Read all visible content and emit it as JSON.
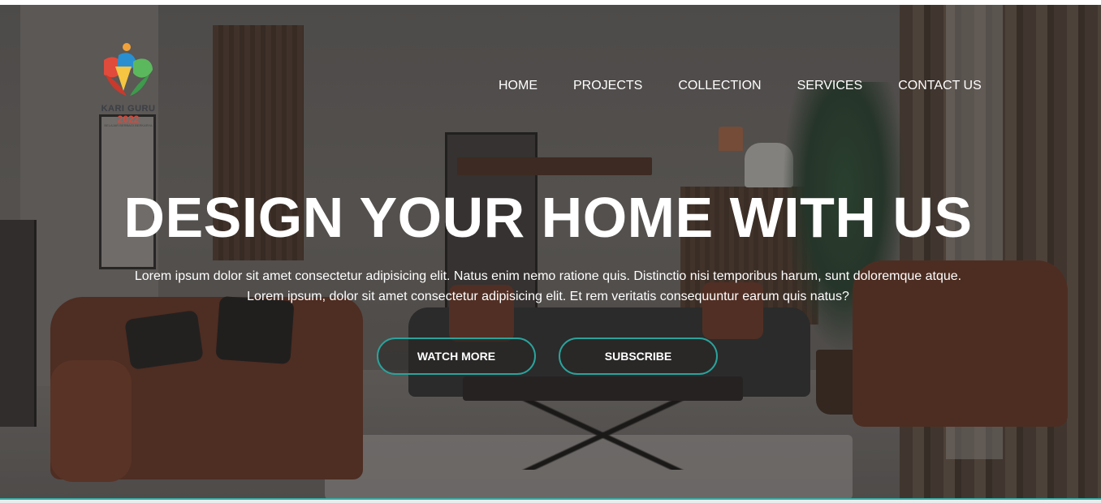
{
  "logo": {
    "name": "KARI GURU",
    "year": "2022",
    "tagline": "BELAJAR BERBAGI BERKARYA",
    "colors": {
      "orange": "#f0a23a",
      "blue": "#2a8fd0",
      "green": "#5cb85c",
      "red": "#e04b3b",
      "yellow": "#f6c542"
    }
  },
  "nav": {
    "items": [
      "HOME",
      "PROJECTS",
      "COLLECTION",
      "SERVICES",
      "CONTACT US"
    ]
  },
  "hero": {
    "headline": "DESIGN YOUR HOME WITH US",
    "paragraph_line1": "Lorem ipsum dolor sit amet consectetur adipisicing elit. Natus enim nemo ratione quis. Distinctio nisi temporibus harum, sunt doloremque atque.",
    "paragraph_line2": "Lorem ipsum, dolor sit amet consectetur adipisicing elit. Et rem veritatis consequuntur earum quis natus?",
    "watch_more_label": "WATCH MORE",
    "subscribe_label": "SUBSCRIBE",
    "accent_color": "#2aa39c"
  }
}
